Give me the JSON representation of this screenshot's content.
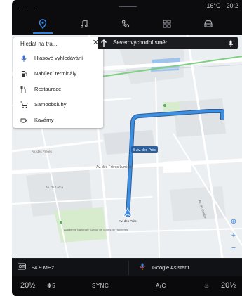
{
  "status_bar": {
    "left_icons": "· · ·",
    "temperature": "16°C",
    "time": "20:2"
  },
  "top_nav": {
    "items": [
      {
        "name": "navigation",
        "icon": "location-pin-icon",
        "active": true
      },
      {
        "name": "music",
        "icon": "music-note-icon",
        "active": false
      },
      {
        "name": "phone",
        "icon": "phone-icon",
        "active": false
      },
      {
        "name": "apps",
        "icon": "grid-icon",
        "active": false
      },
      {
        "name": "vehicle",
        "icon": "car-icon",
        "active": false
      }
    ]
  },
  "search_panel": {
    "query": "Hledat na tra...",
    "items": [
      {
        "label": "Hlasové vyhledávání",
        "icon": "microphone-icon"
      },
      {
        "label": "Nabíjecí terminály",
        "icon": "charging-station-icon"
      },
      {
        "label": "Restaurace",
        "icon": "restaurant-icon"
      },
      {
        "label": "Samoobsluhy",
        "icon": "shopping-cart-icon"
      },
      {
        "label": "Kavárny",
        "icon": "coffee-cup-icon"
      }
    ]
  },
  "direction_banner": {
    "text": "Severovýchodní směr"
  },
  "map": {
    "street_labels": [
      "Av. des Frères Lumière",
      "Av. des Près",
      "Av. des Près",
      "Av. de Lorca",
      "Av. des Frères",
      "Av. du Centre",
      "Académie Nationale School de Sports de Hacheres"
    ],
    "route_label": "5 Av. des Près",
    "colors": {
      "route": "#3f8fe0",
      "route_outline": "#2b5f9e",
      "highway": "#ffffff",
      "blocks": "#dde1e5",
      "park": "#d6eccd"
    }
  },
  "media_bar": {
    "radio": "94.9 MHz",
    "assistant": "Google Asistent"
  },
  "climate_bar": {
    "left_temp": "20½",
    "fan": "5",
    "sync": "SYNC",
    "ac": "A/C",
    "right_temp": "20½"
  }
}
